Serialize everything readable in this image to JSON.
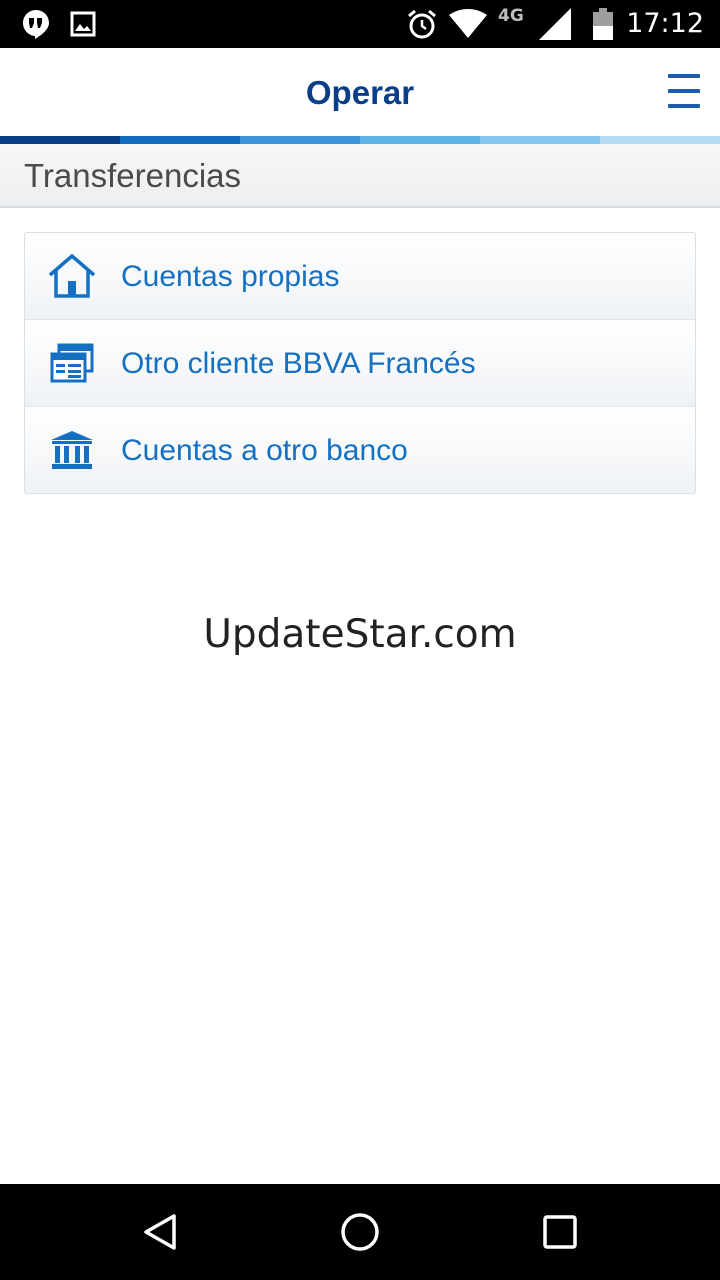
{
  "status_bar": {
    "time": "17:12",
    "network_label": "4G",
    "icons": [
      "hangouts-icon",
      "image-icon",
      "alarm-icon",
      "wifi-icon",
      "signal-icon",
      "battery-icon"
    ]
  },
  "header": {
    "title": "Operar",
    "menu_icon": "hamburger-menu-icon"
  },
  "section": {
    "title": "Transferencias"
  },
  "transfer_options": [
    {
      "label": "Cuentas propias",
      "icon": "house-icon"
    },
    {
      "label": "Otro cliente BBVA Francés",
      "icon": "cards-icon"
    },
    {
      "label": "Cuentas a otro banco",
      "icon": "bank-icon"
    }
  ],
  "watermark": "UpdateStar.com",
  "colors": {
    "title_blue": "#0a3f87",
    "link_blue": "#1570c2",
    "stripe": [
      "#0a3f87",
      "#1269c0",
      "#3d96dc",
      "#5eb3e6",
      "#86c8ef",
      "#b5def5"
    ]
  },
  "nav_bar": {
    "buttons": [
      "back-icon",
      "home-icon",
      "recents-icon"
    ]
  }
}
